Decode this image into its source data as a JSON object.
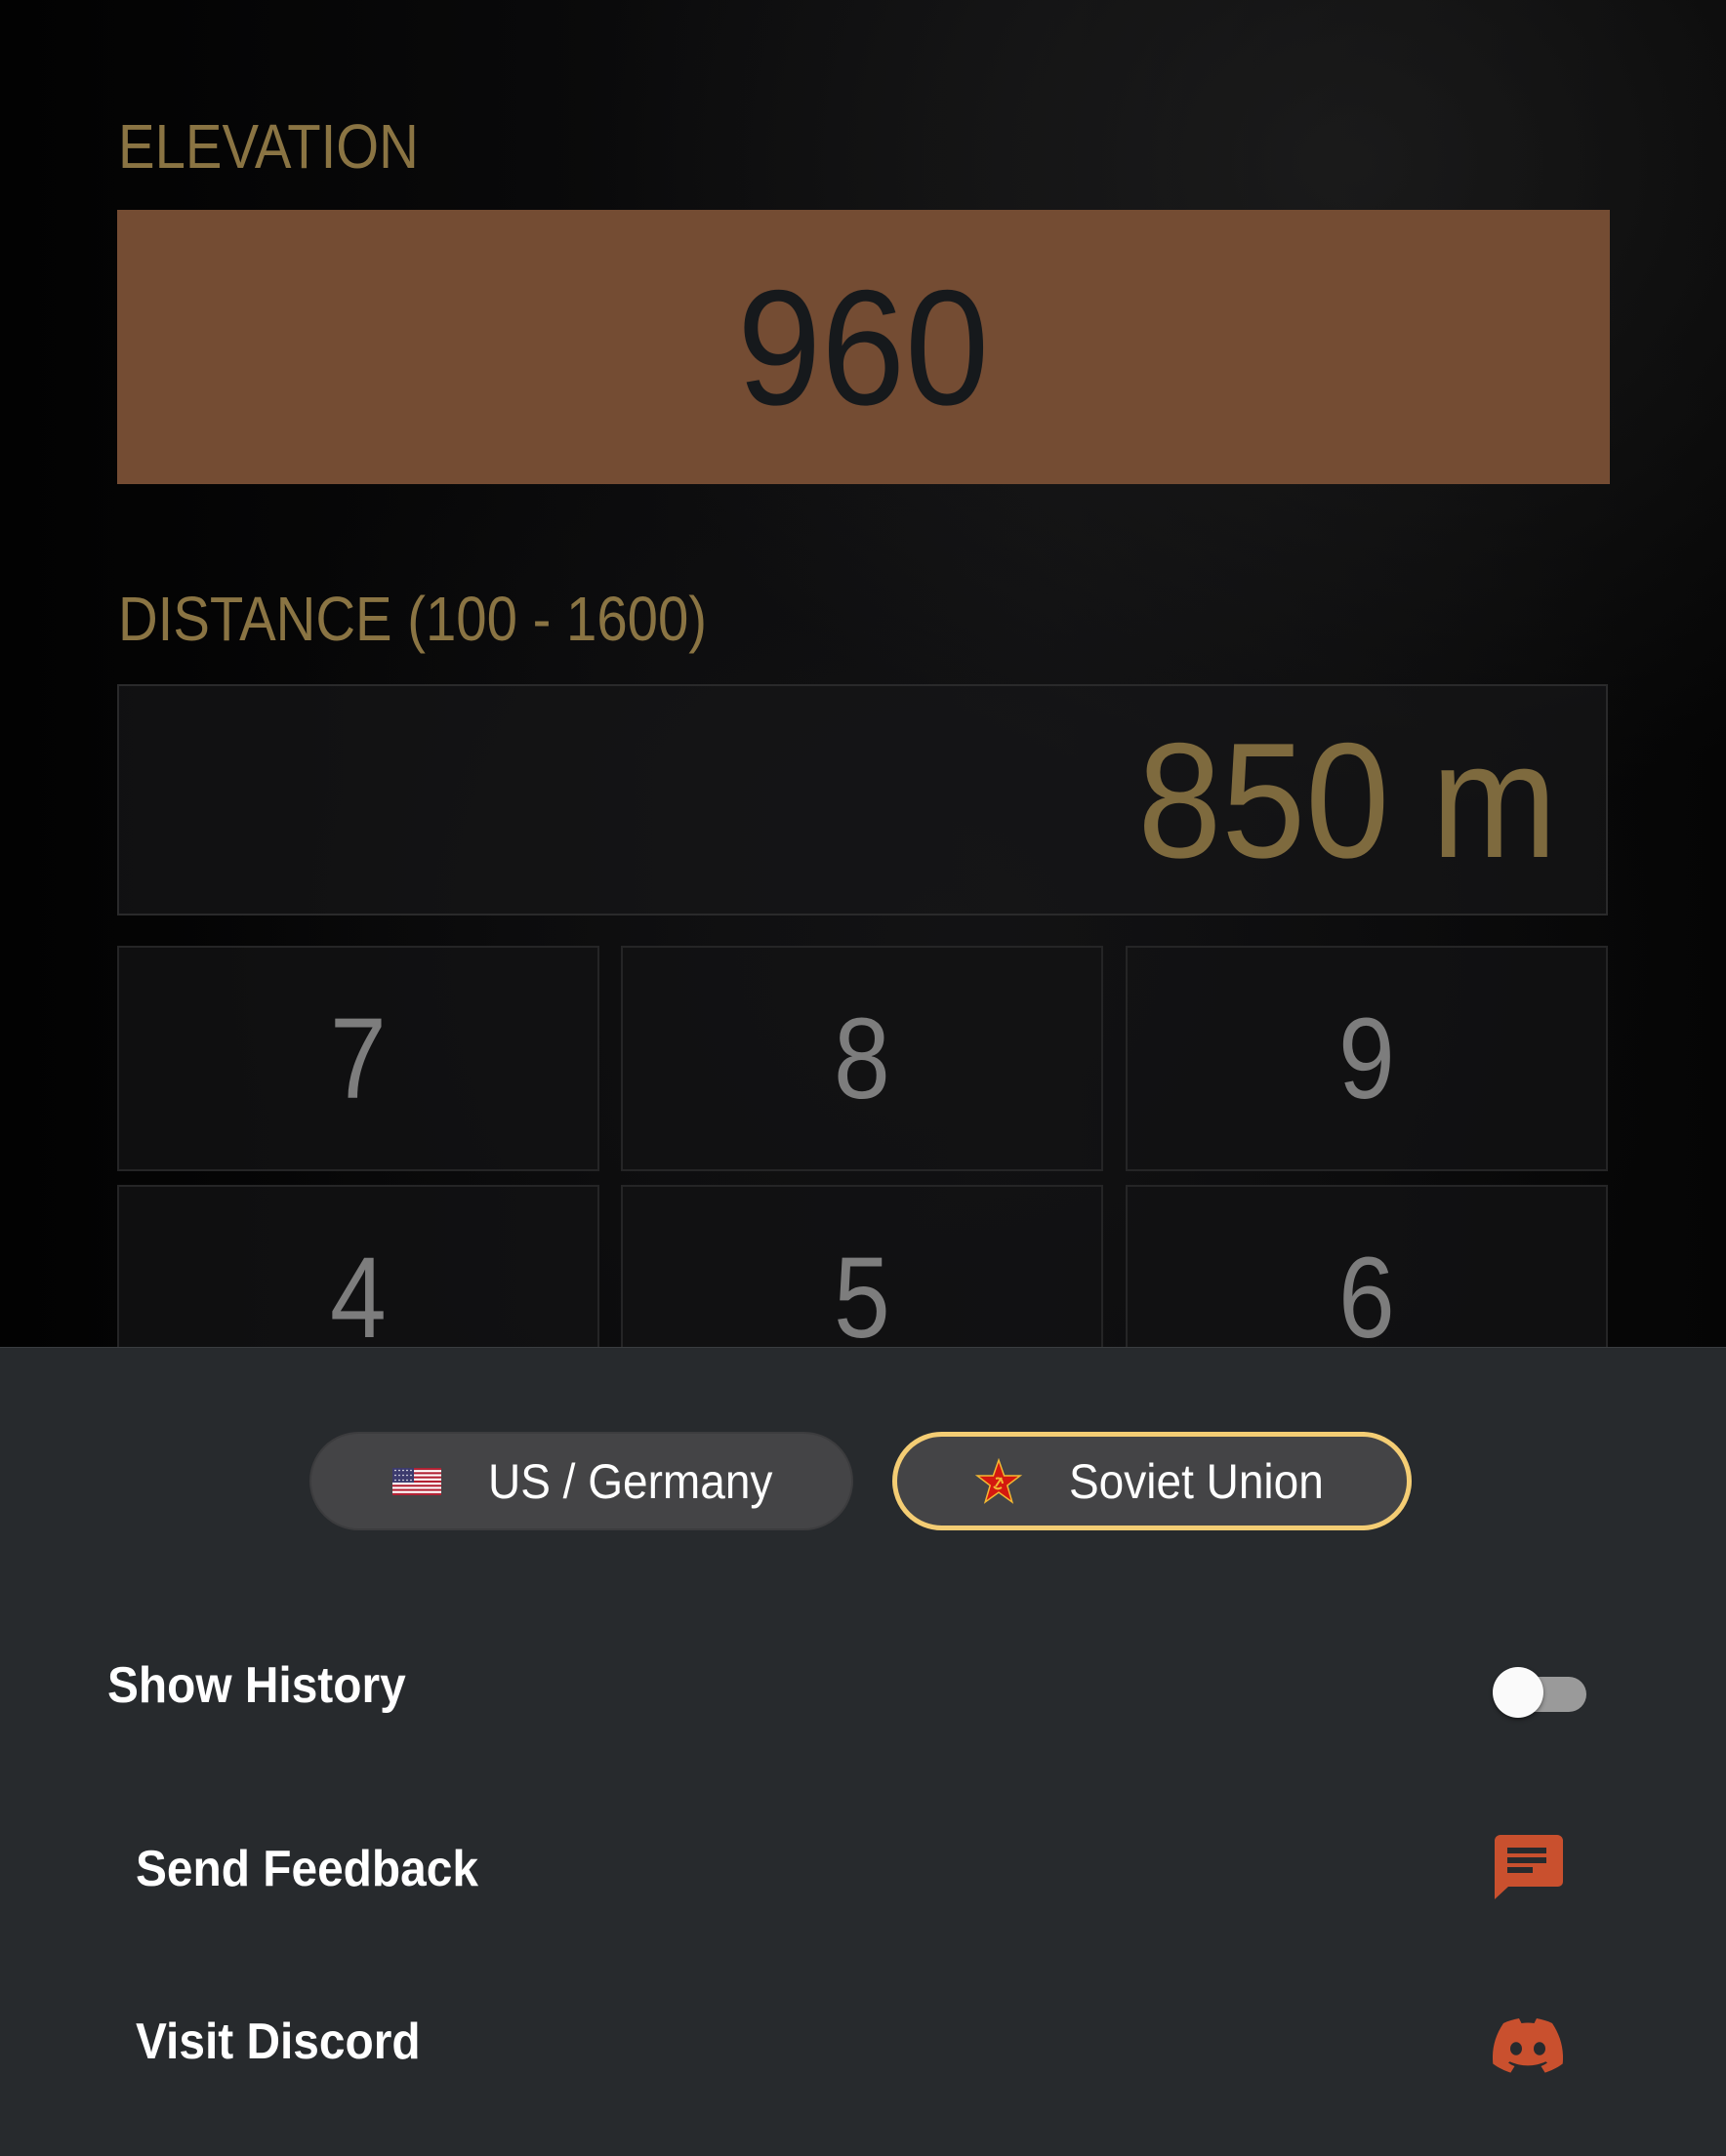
{
  "elevation": {
    "label": "ELEVATION",
    "value": "960",
    "box_color": "#744c33"
  },
  "distance": {
    "label": "DISTANCE (100 - 1600)",
    "value": "850 m",
    "range_min": 100,
    "range_max": 1600
  },
  "keypad": {
    "keys": [
      "7",
      "8",
      "9",
      "4",
      "5",
      "6"
    ]
  },
  "faction_selector": {
    "options": [
      {
        "label": "US / Germany",
        "icon": "us-flag-icon",
        "selected": false
      },
      {
        "label": "Soviet Union",
        "icon": "soviet-star-icon",
        "selected": true
      }
    ],
    "selected_border_color": "#f4cd74"
  },
  "settings": {
    "show_history": {
      "label": "Show History",
      "enabled": false
    },
    "send_feedback": {
      "label": "Send Feedback",
      "icon": "feedback-icon"
    },
    "visit_discord": {
      "label": "Visit Discord",
      "icon": "discord-icon"
    },
    "icon_color": "#c9502e"
  },
  "colors": {
    "label_gold": "#8a7443",
    "distance_value": "#7e6a3e",
    "sheet_background": "#272a2d"
  }
}
